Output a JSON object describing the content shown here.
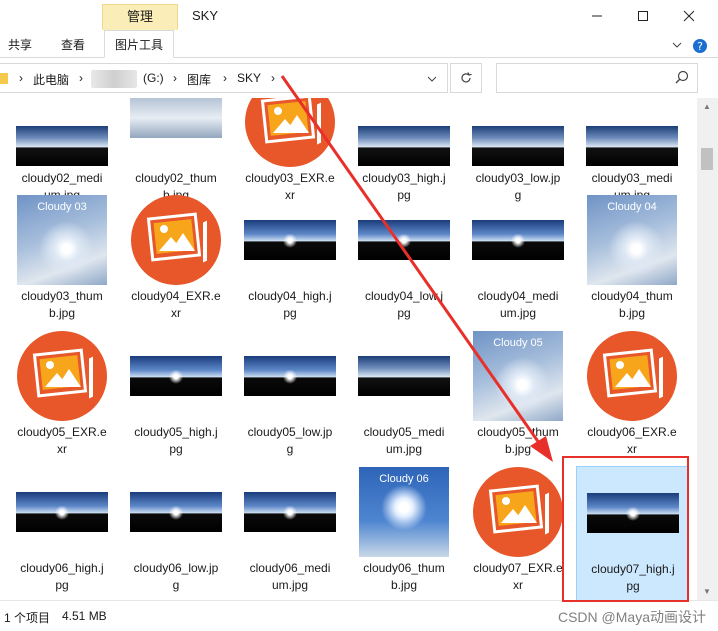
{
  "window": {
    "context_tab": "管理",
    "title": "SKY",
    "min_icon": "minimize-icon",
    "max_icon": "maximize-icon",
    "close_icon": "close-icon"
  },
  "ribbon": {
    "tabs": [
      "共享",
      "查看",
      "图片工具"
    ],
    "active_tab": "图片工具"
  },
  "address": {
    "crumbs": [
      "此电脑",
      "(G:)",
      "图库",
      "SKY"
    ],
    "search_placeholder": ""
  },
  "files": [
    {
      "name": "cloudy02_medium.jpg",
      "label": "cloudy02_medi\num.jpg",
      "kind": "strip"
    },
    {
      "name": "cloudy02_thumb.jpg",
      "label": "cloudy02_thum\nb.jpg",
      "kind": "cloudtop"
    },
    {
      "name": "cloudy03_EXR.exr",
      "label": "cloudy03_EXR.e\nxr",
      "kind": "icon"
    },
    {
      "name": "cloudy03_high.jpg",
      "label": "cloudy03_high.j\npg",
      "kind": "strip"
    },
    {
      "name": "cloudy03_low.jpg",
      "label": "cloudy03_low.jp\ng",
      "kind": "strip"
    },
    {
      "name": "cloudy03_medium.jpg",
      "label": "cloudy03_medi\num.jpg",
      "kind": "strip"
    },
    {
      "name": "cloudy03_thumb.jpg",
      "label": "cloudy03_thum\nb.jpg",
      "kind": "square",
      "tag": "Cloudy 03"
    },
    {
      "name": "cloudy04_EXR.exr",
      "label": "cloudy04_EXR.e\nxr",
      "kind": "icon"
    },
    {
      "name": "cloudy04_high.jpg",
      "label": "cloudy04_high.j\npg",
      "kind": "bright"
    },
    {
      "name": "cloudy04_low.jpg",
      "label": "cloudy04_low.j\npg",
      "kind": "bright"
    },
    {
      "name": "cloudy04_medium.jpg",
      "label": "cloudy04_medi\num.jpg",
      "kind": "bright"
    },
    {
      "name": "cloudy04_thumb.jpg",
      "label": "cloudy04_thum\nb.jpg",
      "kind": "square",
      "tag": "Cloudy 04"
    },
    {
      "name": "cloudy05_EXR.exr",
      "label": "cloudy05_EXR.e\nxr",
      "kind": "icon"
    },
    {
      "name": "cloudy05_high.jpg",
      "label": "cloudy05_high.j\npg",
      "kind": "bright"
    },
    {
      "name": "cloudy05_low.jpg",
      "label": "cloudy05_low.jp\ng",
      "kind": "bright"
    },
    {
      "name": "cloudy05_medium.jpg",
      "label": "cloudy05_medi\num.jpg",
      "kind": "strip"
    },
    {
      "name": "cloudy05_thumb.jpg",
      "label": "cloudy05_thum\nb.jpg",
      "kind": "square",
      "tag": "Cloudy 05"
    },
    {
      "name": "cloudy06_EXR.exr",
      "label": "cloudy06_EXR.e\nxr",
      "kind": "icon"
    },
    {
      "name": "cloudy06_high.jpg",
      "label": "cloudy06_high.j\npg",
      "kind": "bright"
    },
    {
      "name": "cloudy06_low.jpg",
      "label": "cloudy06_low.jp\ng",
      "kind": "bright"
    },
    {
      "name": "cloudy06_medium.jpg",
      "label": "cloudy06_medi\num.jpg",
      "kind": "bright"
    },
    {
      "name": "cloudy06_thumb.jpg",
      "label": "cloudy06_thum\nb.jpg",
      "kind": "squareblue",
      "tag": "Cloudy 06"
    },
    {
      "name": "cloudy07_EXR.exr",
      "label": "cloudy07_EXR.e\nxr",
      "kind": "icon"
    },
    {
      "name": "cloudy07_high.jpg",
      "label": "cloudy07_high.j\npg",
      "kind": "bright",
      "selected": true
    }
  ],
  "status": {
    "count_text": "1 个项目",
    "size_text": "4.51 MB",
    "watermark": "CSDN @Maya动画设计"
  },
  "colors": {
    "annotation_red": "#e8302a",
    "selection_fill": "#cce8ff",
    "context_tab_fill": "#fbedb8"
  }
}
